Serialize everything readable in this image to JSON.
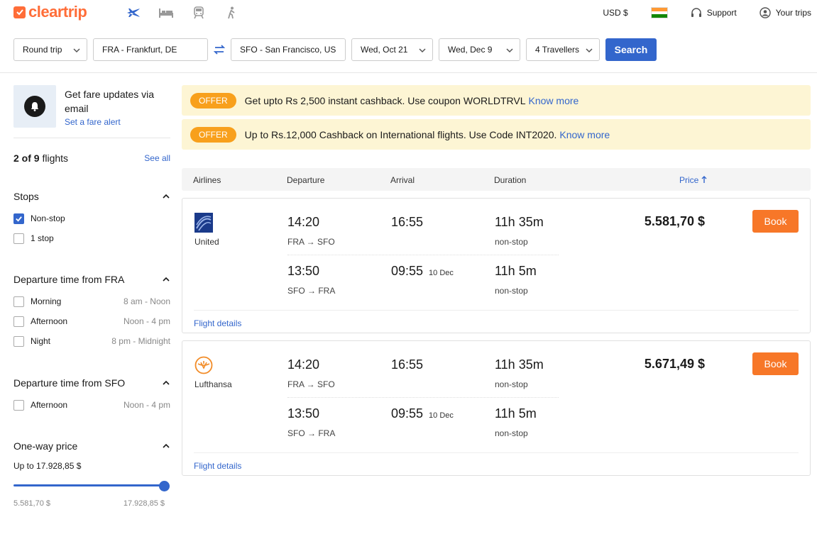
{
  "brand": {
    "name": "cleartrip",
    "accent": "#ff6d38"
  },
  "nav": {
    "icons": [
      "plane-icon",
      "hotel-icon",
      "train-icon",
      "activity-icon"
    ]
  },
  "header": {
    "currency": "USD $",
    "support": "Support",
    "trips": "Your trips"
  },
  "search": {
    "trip_type": "Round trip",
    "from": "FRA - Frankfurt, DE",
    "to": "SFO - San Francisco, US",
    "depart": "Wed, Oct 21",
    "return": "Wed, Dec 9",
    "travellers": "4 Travellers",
    "button": "Search"
  },
  "sidebar": {
    "alert_title": "Get fare updates via email",
    "alert_link": "Set a fare alert",
    "count_bold": "2 of 9",
    "count_rest": " flights",
    "see_all": "See all",
    "stops": {
      "title": "Stops",
      "options": [
        {
          "label": "Non-stop",
          "checked": true
        },
        {
          "label": "1 stop",
          "checked": false
        }
      ]
    },
    "dep_fra": {
      "title": "Departure time from FRA",
      "options": [
        {
          "label": "Morning",
          "range": "8 am - Noon"
        },
        {
          "label": "Afternoon",
          "range": "Noon - 4 pm"
        },
        {
          "label": "Night",
          "range": "8 pm - Midnight"
        }
      ]
    },
    "dep_sfo": {
      "title": "Departure time from SFO",
      "options": [
        {
          "label": "Afternoon",
          "range": "Noon - 4 pm"
        }
      ]
    },
    "price": {
      "title": "One-way price",
      "up_to": "Up to 17.928,85 $",
      "min": "5.581,70 $",
      "max": "17.928,85 $",
      "level": 1.0
    }
  },
  "offers": [
    {
      "badge": "OFFER",
      "text": "Get upto Rs 2,500 instant cashback. Use coupon WORLDTRVL",
      "link": "Know more"
    },
    {
      "badge": "OFFER",
      "text": "Up to Rs.12,000 Cashback on International flights. Use Code INT2020.",
      "link": "Know more"
    }
  ],
  "columns": {
    "airlines": "Airlines",
    "departure": "Departure",
    "arrival": "Arrival",
    "duration": "Duration",
    "price": "Price"
  },
  "flights": [
    {
      "airline": "United",
      "logo": "united-logo",
      "out": {
        "dep": "14:20",
        "arr": "16:55",
        "route": "FRA → SFO",
        "duration": "11h 35m",
        "stops": "non-stop"
      },
      "ret": {
        "dep": "13:50",
        "arr": "09:55",
        "arr_note": "10 Dec",
        "route": "SFO → FRA",
        "duration": "11h 5m",
        "stops": "non-stop"
      },
      "price": "5.581,70 $",
      "book": "Book",
      "details": "Flight details"
    },
    {
      "airline": "Lufthansa",
      "logo": "lufthansa-logo",
      "out": {
        "dep": "14:20",
        "arr": "16:55",
        "route": "FRA → SFO",
        "duration": "11h 35m",
        "stops": "non-stop"
      },
      "ret": {
        "dep": "13:50",
        "arr": "09:55",
        "arr_note": "10 Dec",
        "route": "SFO → FRA",
        "duration": "11h 5m",
        "stops": "non-stop"
      },
      "price": "5.671,49 $",
      "book": "Book",
      "details": "Flight details"
    }
  ]
}
